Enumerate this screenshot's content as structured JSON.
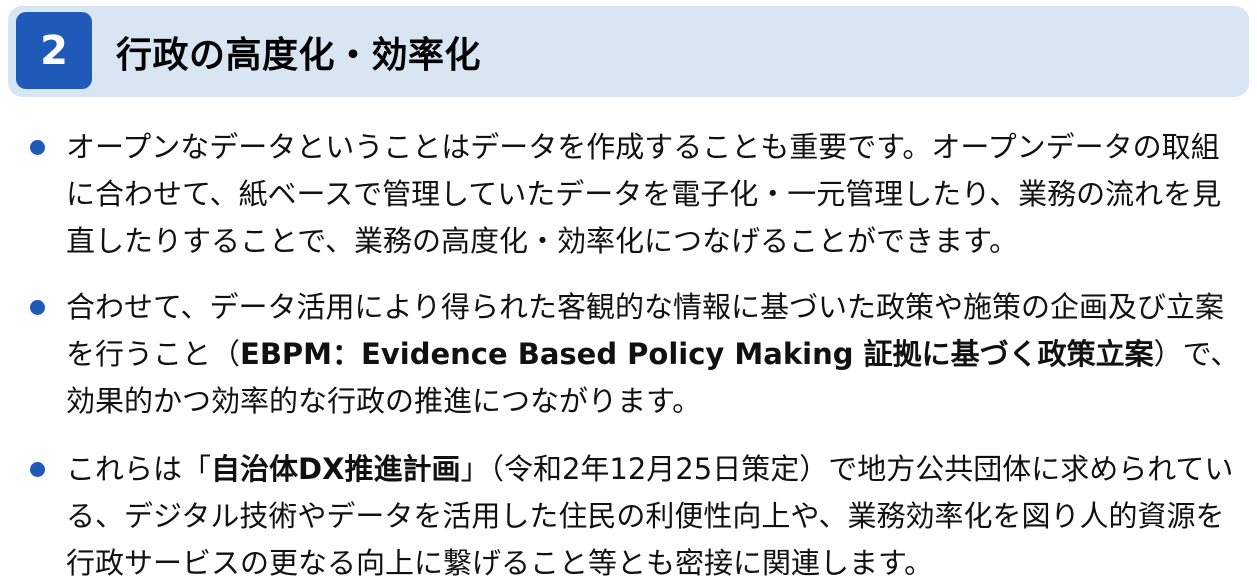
{
  "header": {
    "number": "2",
    "title": "行政の高度化・効率化",
    "colors": {
      "background": "#d8e6f3",
      "number_box": "#1f5ab8",
      "bullet": "#1f5ab8"
    }
  },
  "bullets": [
    {
      "text": "オープンなデータということはデータを作成することも重要です。オープンデータの取組に合わせて、紙ベースで管理していたデータを電子化・一元管理したり、業務の流れを見直したりすることで、業務の高度化・効率化につなげることができます。"
    },
    {
      "pre": "合わせて、データ活用により得られた客観的な情報に基づいた政策や施策の企画及び立案を行うこと（",
      "bold": "EBPM：Evidence Based Policy Making 証拠に基づく政策立案",
      "post": "）で、効果的かつ効率的な行政の推進につながります。"
    },
    {
      "pre": "これらは「",
      "bold": "自治体DX推進計画",
      "post": "」（令和2年12月25日策定）で地方公共団体に求められている、デジタル技術やデータを活用した住民の利便性向上や、業務効率化を図り人的資源を行政サービスの更なる向上に繋げること等とも密接に関連します。"
    }
  ]
}
